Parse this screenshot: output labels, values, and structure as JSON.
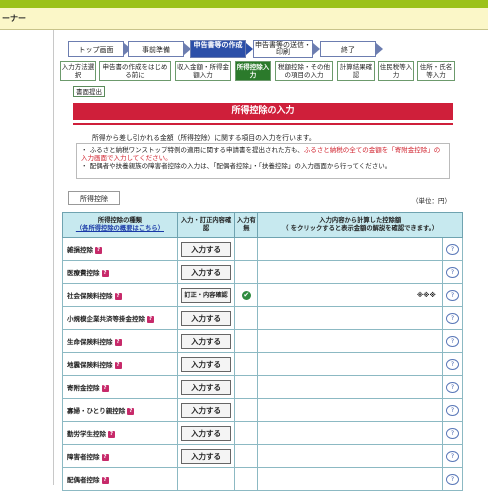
{
  "header": {
    "title": "ーナー"
  },
  "steps_row1": [
    "トップ画面",
    "事前準備",
    "申告書等の作成",
    "申告書等の送信・印刷",
    "終了"
  ],
  "steps_row2": [
    "入力方法選択",
    "申告書の作成をはじめる前に",
    "収入金額・所得金額入力",
    "所得控除入力",
    "税額控除・その他の項目の入力",
    "計算結果確認",
    "住民税等入力",
    "住所・氏名等入力"
  ],
  "submit_button": "書面提出",
  "section_title": "所得控除の入力",
  "description": "所得から差し引かれる金額（所得控除）に関する項目の入力を行います。",
  "notes": {
    "line1a": "ふるさと納税ワンストップ特例の適用に関する申請書を提出された方も、",
    "line1b": "ふるさと納税の全ての金額を「寄附金控除」の入力画面で入力してください。",
    "line2": "配偶者や扶養親族の障害者控除の入力は、「配偶者控除」・「扶養控除」の入力画面から行ってください。"
  },
  "tab": "所得控除",
  "unit": "（単位：円）",
  "table_header": {
    "col1": "所得控除の種類",
    "col1_link": "（各所得控除の概要はこちら）",
    "col2": "入力・訂正内容確認",
    "col3": "入力有無",
    "col4a": "入力内容から計算した控除額",
    "col4b": "（ をクリックすると表示金額の解説を確認できます。）"
  },
  "rows": [
    {
      "name": "雑損控除",
      "action": "入力する",
      "status": "",
      "amount": ""
    },
    {
      "name": "医療費控除",
      "action": "入力する",
      "status": "",
      "amount": ""
    },
    {
      "name": "社会保険料控除",
      "action": "訂正・内容確認",
      "status": "✔",
      "amount": "※※※"
    },
    {
      "name": "小規模企業共済等掛金控除",
      "action": "入力する",
      "status": "",
      "amount": ""
    },
    {
      "name": "生命保険料控除",
      "action": "入力する",
      "status": "",
      "amount": ""
    },
    {
      "name": "地震保険料控除",
      "action": "入力する",
      "status": "",
      "amount": ""
    },
    {
      "name": "寄附金控除",
      "action": "入力する",
      "status": "",
      "amount": ""
    },
    {
      "name": "寡婦・ひとり親控除",
      "action": "入力する",
      "status": "",
      "amount": ""
    },
    {
      "name": "勤労学生控除",
      "action": "入力する",
      "status": "",
      "amount": ""
    },
    {
      "name": "障害者控除",
      "action": "入力する",
      "status": "",
      "amount": ""
    },
    {
      "name": "配偶者控除",
      "action": "",
      "status": "",
      "amount": ""
    }
  ],
  "help_icon": "help-bubble-icon",
  "question_icon": "question-icon"
}
